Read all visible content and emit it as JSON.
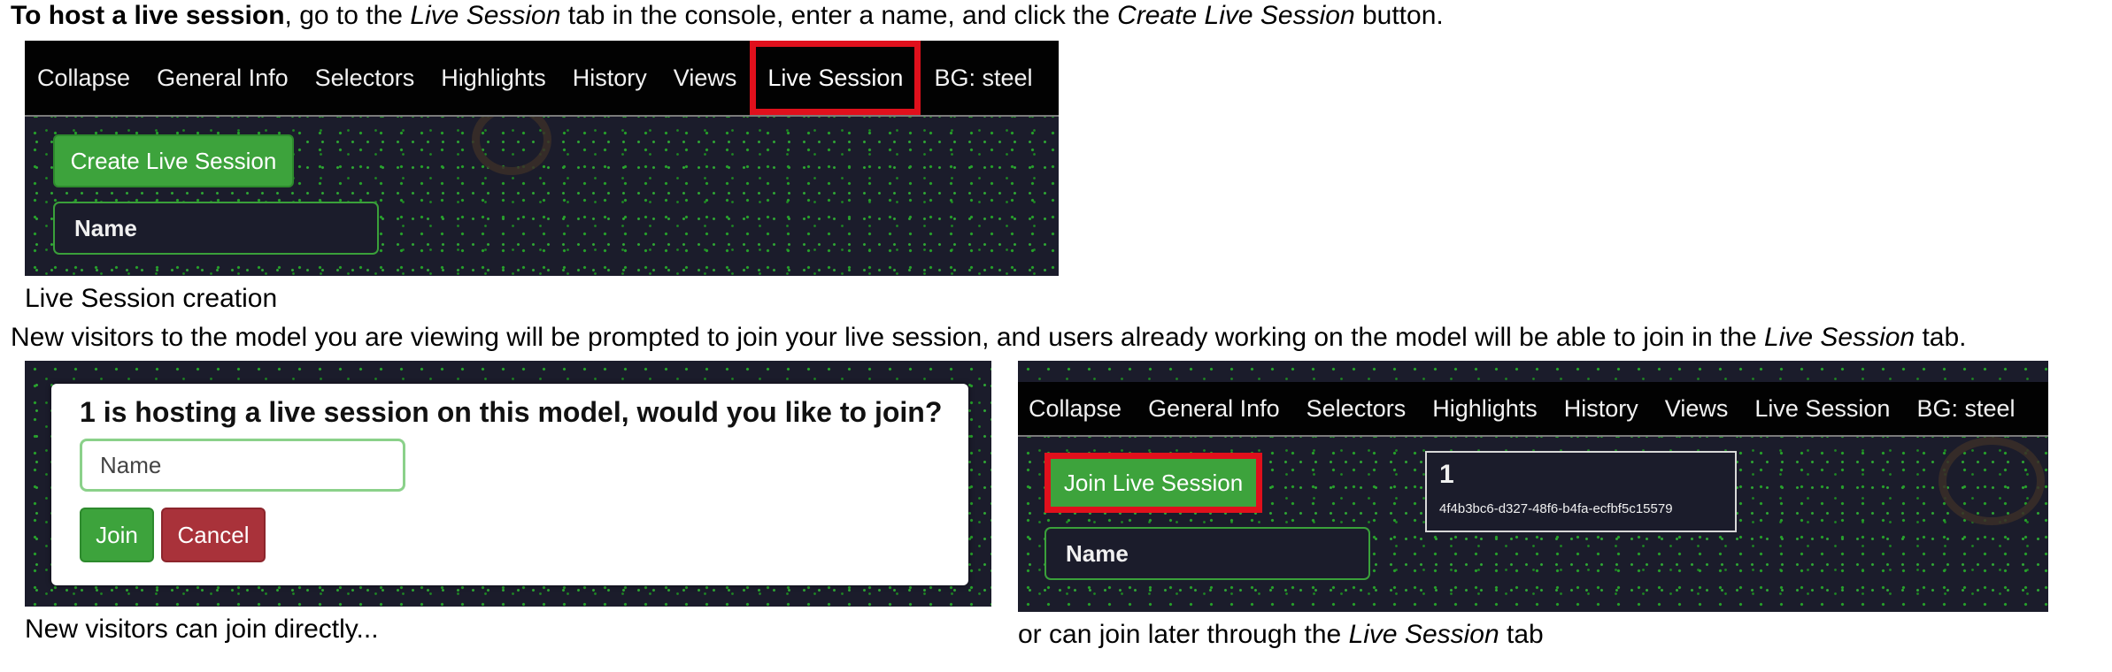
{
  "intro": {
    "bold": "To host a live session",
    "t1": ", go to the ",
    "i1": "Live Session",
    "t2": " tab in the console, enter a name, and click the ",
    "i2": "Create Live Session",
    "t3": " button."
  },
  "panel1": {
    "menu": [
      "Collapse",
      "General Info",
      "Selectors",
      "Highlights",
      "History",
      "Views",
      "Live Session",
      "BG: steel"
    ],
    "active_tab": "Live Session",
    "create_button": "Create Live Session",
    "name_placeholder": "Name"
  },
  "caption1": "Live Session creation",
  "para2": {
    "text": "New visitors to the model you are viewing will be prompted to join your live session, and users already working on the model will be able to join in the ",
    "italic": "Live Session",
    "end": " tab."
  },
  "panel2": {
    "dialog_title": "1 is hosting a live session on this model, would you like to join?",
    "name_placeholder": "Name",
    "join_button": "Join",
    "cancel_button": "Cancel"
  },
  "caption2": "New visitors can join directly...",
  "panel3": {
    "menu": [
      "Collapse",
      "General Info",
      "Selectors",
      "Highlights",
      "History",
      "Views",
      "Live Session",
      "BG: steel"
    ],
    "join_button": "Join Live Session",
    "name_placeholder": "Name",
    "session": {
      "host": "1",
      "id": "4f4b3bc6-d327-48f6-b4fa-ecfbf5c15579"
    }
  },
  "caption3": {
    "text": "or can join later through the ",
    "italic": "Live Session",
    "end": " tab"
  },
  "colors": {
    "accent_green": "#3da33c",
    "cancel_red": "#a9323a",
    "highlight_red": "#e0101c",
    "menubar": "#020202"
  }
}
